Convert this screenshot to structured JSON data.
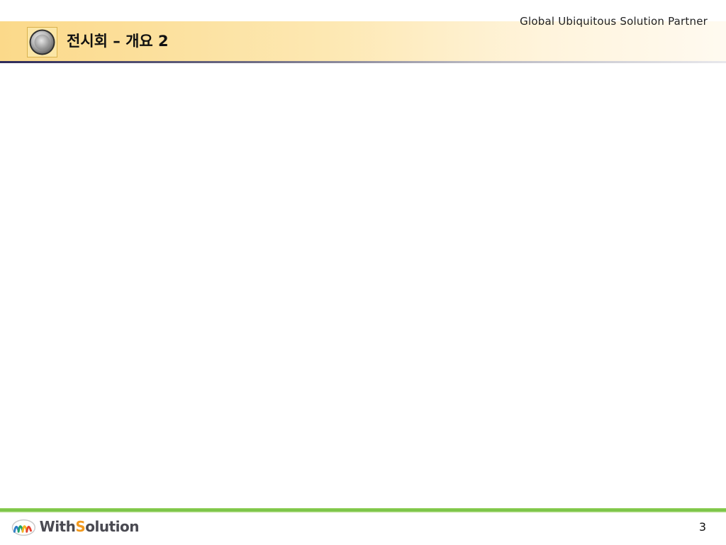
{
  "header": {
    "tagline": "Global Ubiquitous Solution Partner",
    "title": "전시회 – 개요 2",
    "icon": "round-button-icon"
  },
  "footer": {
    "logo_text_prefix": "With",
    "logo_text_accent": "S",
    "logo_text_suffix": "olution",
    "logo_icon": "withsolution-logo-icon",
    "page_number": "3"
  },
  "colors": {
    "header_gold": "#fbd98a",
    "header_rule": "#2e2b5a",
    "footer_green": "#6fbf3a",
    "logo_accent": "#f29a1f"
  }
}
